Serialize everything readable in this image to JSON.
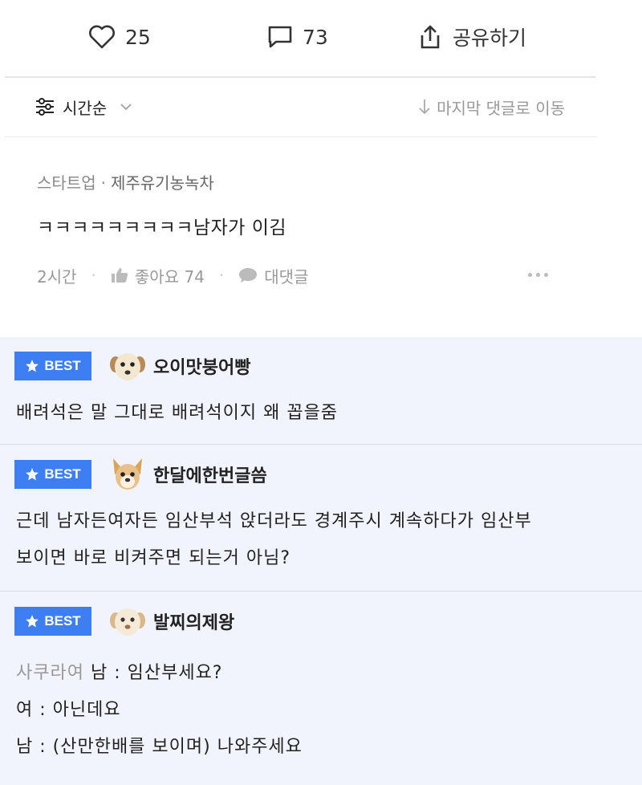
{
  "actions": {
    "like_count": "25",
    "comment_count": "73",
    "share_label": "공유하기"
  },
  "sortbar": {
    "sort_label": "시간순",
    "last_comment_label": "마지막 댓글로 이동"
  },
  "comment": {
    "meta_prefix": "스타트업",
    "company": "제주유기농녹차",
    "text": "ㅋㅋㅋㅋㅋㅋㅋㅋㅋ남자가 이김",
    "time": "2시간",
    "like_label": "좋아요 74",
    "reply_label": "대댓글"
  },
  "best_badge": "BEST",
  "best": [
    {
      "nickname": "오이맛붕어빵",
      "lines": [
        "배려석은 말 그대로 배려석이지 왜 꼽을줌"
      ]
    },
    {
      "nickname": "한달에한번글씀",
      "lines": [
        "근데 남자든여자든 임산부석 앉더라도 경계주시 계속하다가 임산부",
        "보이면 바로 비켜주면 되는거 아님?"
      ]
    },
    {
      "nickname": "발찌의제왕",
      "muted_prefix": "사쿠라여",
      "lines": [
        "남 : 임산부세요?",
        "여 : 아닌데요",
        "남 : (산만한배를 보이며) 나와주세요"
      ]
    }
  ],
  "colors": {
    "accent": "#3d7ef2",
    "best_bg": "#f1f4fd"
  },
  "icons": [
    "heart-icon",
    "comment-icon",
    "share-icon",
    "sort-filter-icon",
    "chevron-down-icon",
    "arrow-down-icon",
    "thumb-up-icon",
    "reply-bubble-icon",
    "more-dots-icon",
    "star-icon",
    "avatar-dog-icon"
  ]
}
